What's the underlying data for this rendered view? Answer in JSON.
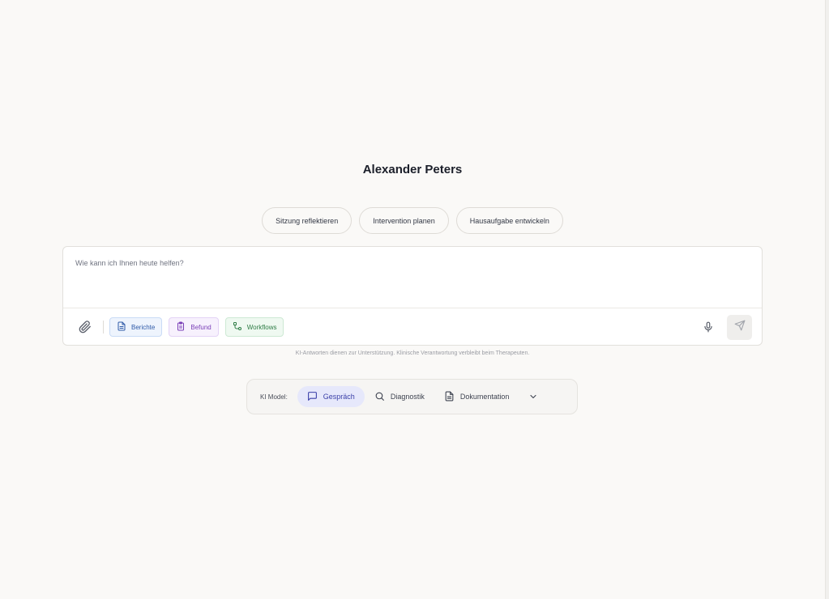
{
  "header": {
    "title": "Alexander Peters"
  },
  "suggestions": [
    {
      "label": "Sitzung reflektieren"
    },
    {
      "label": "Intervention planen"
    },
    {
      "label": "Hausaufgabe entwickeln"
    }
  ],
  "composer": {
    "placeholder": "Wie kann ich Ihnen heute helfen?",
    "attach_icon": "paperclip-icon",
    "tools": [
      {
        "label": "Berichte",
        "icon": "document-icon",
        "color": "#2f5aa8"
      },
      {
        "label": "Befund",
        "icon": "clipboard-icon",
        "color": "#7a3fb7"
      },
      {
        "label": "Workflows",
        "icon": "workflow-icon",
        "color": "#2e7c45"
      }
    ],
    "mic_icon": "microphone-icon",
    "send_icon": "send-icon"
  },
  "disclaimer": "KI-Antworten dienen zur Unterstützung. Klinische Verantwortung verbleibt beim Therapeuten.",
  "model_selector": {
    "label": "KI Model:",
    "options": [
      {
        "label": "Gespräch",
        "icon": "chat-bubble-icon",
        "active": true
      },
      {
        "label": "Diagnostik",
        "icon": "search-icon",
        "active": false
      },
      {
        "label": "Dokumentation",
        "icon": "document-icon",
        "active": false
      }
    ],
    "more_icon": "chevron-down-icon",
    "accent": "#3a3fa8"
  }
}
